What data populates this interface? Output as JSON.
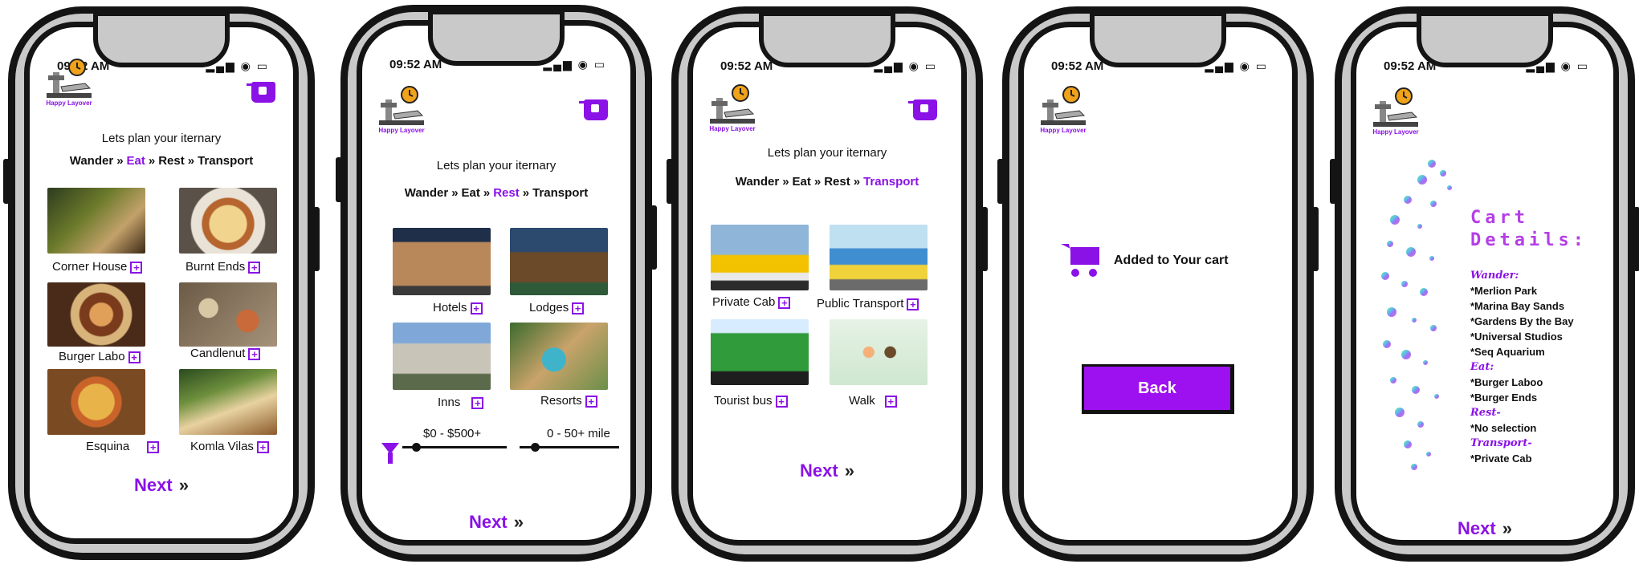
{
  "screens": {
    "eat": {
      "time": "09:52 AM",
      "logo_text": "Happy Layover",
      "heading": "Lets plan your iternary",
      "steps": [
        "Wander",
        "Eat",
        "Rest",
        "Transport"
      ],
      "active_step": "Eat",
      "items": [
        "Corner House",
        "Burnt Ends",
        "Burger Labo",
        "Candlenut",
        "Esquina",
        "Komla Vilas"
      ],
      "next": "Next"
    },
    "rest": {
      "time": "09:52 AM",
      "logo_text": "Happy Layover",
      "heading": "Lets plan your iternary",
      "steps": [
        "Wander",
        "Eat",
        "Rest",
        "Transport"
      ],
      "active_step": "Rest",
      "items": [
        "Hotels",
        "Lodges",
        "Inns",
        "Resorts"
      ],
      "price_filter": "$0 - $500+",
      "distance_filter": "0 - 50+ mile",
      "next": "Next"
    },
    "transport": {
      "time": "09:52 AM",
      "logo_text": "Happy Layover",
      "heading": "Lets plan your iternary",
      "steps": [
        "Wander",
        "Eat",
        "Rest",
        "Transport"
      ],
      "active_step": "Transport",
      "items": [
        "Private Cab",
        "Public Transport",
        "Tourist bus",
        "Walk"
      ],
      "next": "Next"
    },
    "added": {
      "time": "09:52 AM",
      "logo_text": "Happy Layover",
      "message": "Added to Your cart",
      "back": "Back"
    },
    "cart": {
      "time": "09:52 AM",
      "logo_text": "Happy Layover",
      "title_line1": "Cart",
      "title_line2": "Details:",
      "wander_label": "Wander:",
      "wander_items": [
        "*Merlion Park",
        "*Marina Bay Sands",
        "*Gardens By the Bay",
        "*Universal Studios",
        "*Seq Aquarium"
      ],
      "eat_label": "Eat:",
      "eat_items": [
        "*Burger Laboo",
        "*Burger Ends"
      ],
      "rest_label": "Rest-",
      "rest_items": [
        "*No selection"
      ],
      "transport_label": "Transport-",
      "transport_items": [
        "*Private Cab"
      ],
      "next": "Next"
    }
  },
  "colors": {
    "accent": "#8a12e6",
    "frame": "#141414",
    "bezel": "#c9c9c9"
  },
  "icons": [
    "cart-icon",
    "filter-icon",
    "signal-icon",
    "wifi-icon",
    "battery-icon",
    "chevron-right-icon"
  ]
}
